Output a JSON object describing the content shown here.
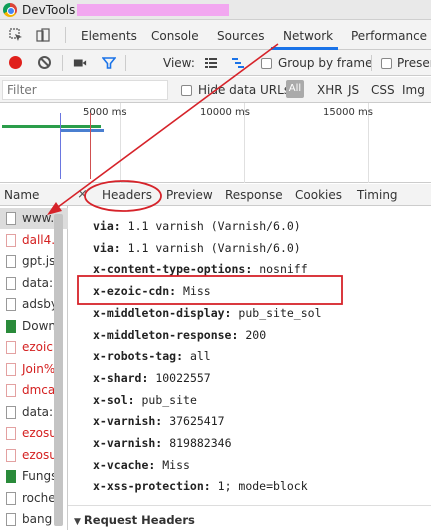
{
  "window": {
    "title": "DevTools -"
  },
  "tabs": [
    "Elements",
    "Console",
    "Sources",
    "Network",
    "Performance"
  ],
  "selected_tab": "Network",
  "toolbar": {
    "view_label": "View:",
    "group_by_frame": "Group by frame",
    "preserve": "Preser"
  },
  "filter": {
    "placeholder": "Filter",
    "hide_data_urls": "Hide data URLs",
    "all": "All",
    "types": [
      "XHR",
      "JS",
      "CSS",
      "Img"
    ]
  },
  "overview": {
    "ticks": [
      "5000 ms",
      "10000 ms",
      "15000 ms"
    ]
  },
  "requests": {
    "header": "Name",
    "rows": [
      {
        "name": "www.",
        "color": "normal",
        "icon": "doc",
        "selected": true
      },
      {
        "name": "dall4.",
        "color": "red",
        "icon": "doc"
      },
      {
        "name": "gpt.js",
        "color": "normal",
        "icon": "doc"
      },
      {
        "name": "data:i",
        "color": "normal",
        "icon": "doc"
      },
      {
        "name": "adsby",
        "color": "normal",
        "icon": "doc"
      },
      {
        "name": "Down",
        "color": "normal",
        "icon": "green"
      },
      {
        "name": "ezoic",
        "color": "red",
        "icon": "doc"
      },
      {
        "name": "Join%",
        "color": "red",
        "icon": "doc"
      },
      {
        "name": "dmca",
        "color": "red",
        "icon": "doc"
      },
      {
        "name": "data:i",
        "color": "normal",
        "icon": "doc"
      },
      {
        "name": "ezosu",
        "color": "red",
        "icon": "doc"
      },
      {
        "name": "ezosu",
        "color": "red",
        "icon": "doc"
      },
      {
        "name": "Fungs",
        "color": "normal",
        "icon": "green"
      },
      {
        "name": "roche",
        "color": "normal",
        "icon": "doc"
      },
      {
        "name": "bang",
        "color": "normal",
        "icon": "doc"
      }
    ]
  },
  "details": {
    "close": "×",
    "tabs": [
      "Headers",
      "Preview",
      "Response",
      "Cookies",
      "Timing"
    ],
    "selected_tab": "Headers",
    "headers": [
      {
        "key": "via:",
        "value": "1.1 varnish (Varnish/6.0)"
      },
      {
        "key": "via:",
        "value": "1.1 varnish (Varnish/6.0)"
      },
      {
        "key": "x-content-type-options:",
        "value": "nosniff"
      },
      {
        "key": "x-ezoic-cdn:",
        "value": "Miss"
      },
      {
        "key": "x-middleton-display:",
        "value": "pub_site_sol"
      },
      {
        "key": "x-middleton-response:",
        "value": "200"
      },
      {
        "key": "x-robots-tag:",
        "value": "all"
      },
      {
        "key": "x-shard:",
        "value": "10022557"
      },
      {
        "key": "x-sol:",
        "value": "pub_site"
      },
      {
        "key": "x-varnish:",
        "value": "37625417"
      },
      {
        "key": "x-varnish:",
        "value": "819882346"
      },
      {
        "key": "x-vcache:",
        "value": "Miss"
      },
      {
        "key": "x-xss-protection:",
        "value": "1; mode=block"
      }
    ],
    "section": "Request Headers"
  },
  "colors": {
    "accent": "#1a73e8",
    "annotation": "#d6232a",
    "record": "#e0201b",
    "redacted": "#f2a7f0"
  }
}
